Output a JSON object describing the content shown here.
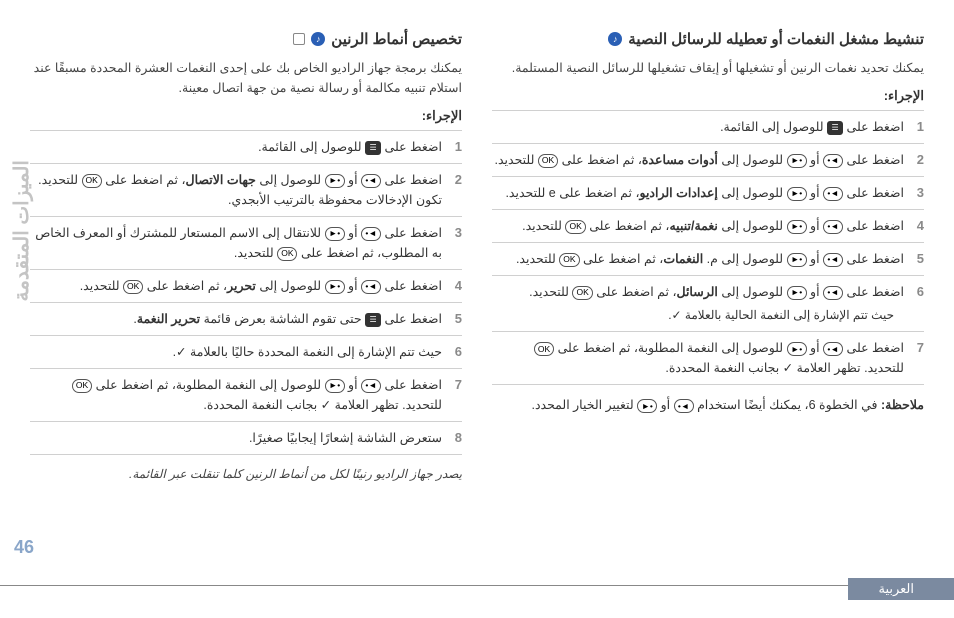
{
  "icons": {
    "menu": "☰",
    "left": "◄•",
    "right": "•►",
    "ok": "OK"
  },
  "right_col": {
    "title": "تنشيط مشغل النغمات أو تعطيله للرسائل النصية",
    "intro": "يمكنك تحديد نغمات الرنين أو تشغيلها أو إيقاف تشغيلها للرسائل النصية المستلمة.",
    "proc_label": "الإجراء:",
    "steps": [
      {
        "text": "اضغط على {menu} للوصول إلى القائمة."
      },
      {
        "text": "اضغط على {left} أو {right} للوصول إلى <b>أدوات مساعدة</b>، ثم اضغط على {ok} للتحديد."
      },
      {
        "text": "اضغط على {left} أو {right} للوصول إلى <b>إعدادات الراديو</b>، ثم اضغط على e للتحديد."
      },
      {
        "text": "اضغط على {left} أو {right} للوصول إلى <b>نغمة/تنبيه</b>، ثم اضغط على {ok} للتحديد."
      },
      {
        "text": "اضغط على {left} أو {right} للوصول إلى م. <b>النغمات</b>، ثم اضغط على {ok} للتحديد."
      },
      {
        "text": "اضغط على {left} أو {right} للوصول إلى <b>الرسائل</b>، ثم اضغط على {ok} للتحديد.",
        "sub": "حيث تتم الإشارة إلى النغمة الحالية بالعلامة ✓."
      },
      {
        "text": "اضغط على {left} أو {right} للوصول إلى النغمة المطلوبة، ثم اضغط على {ok} للتحديد. تظهر العلامة ✓ بجانب النغمة المحددة."
      }
    ],
    "note_label": "ملاحظة:",
    "note_text": "في الخطوة 6، يمكنك أيضًا استخدام {left} أو {right} لتغيير الخيار المحدد."
  },
  "left_col": {
    "title": "تخصيص أنماط الرنين",
    "intro": "يمكنك برمجة جهاز الراديو الخاص بك على إحدى النغمات العشرة المحددة مسبقًا عند استلام تنبيه مكالمة أو رسالة نصية من جهة اتصال معينة.",
    "proc_label": "الإجراء:",
    "steps": [
      {
        "text": "اضغط على {menu} للوصول إلى القائمة."
      },
      {
        "text": "اضغط على {left} أو {right} للوصول إلى <b>جهات الاتصال</b>، ثم اضغط على {ok} للتحديد. تكون الإدخالات محفوظة بالترتيب الأبجدي."
      },
      {
        "text": "اضغط على {left} أو {right} للانتقال إلى الاسم المستعار للمشترك أو المعرف الخاص به المطلوب، ثم اضغط على {ok} للتحديد."
      },
      {
        "text": "اضغط على {left} أو {right} للوصول إلى <b>تحرير</b>، ثم اضغط على {ok} للتحديد."
      },
      {
        "text": "اضغط على {menu} حتى تقوم الشاشة بعرض قائمة <b>تحرير النغمة</b>."
      },
      {
        "text": "حيث تتم الإشارة إلى النغمة المحددة حاليًا بالعلامة ✓."
      },
      {
        "text": "اضغط على {left} أو {right} للوصول إلى النغمة المطلوبة، ثم اضغط على {ok} للتحديد. تظهر العلامة ✓ بجانب النغمة المحددة."
      },
      {
        "text": "ستعرض الشاشة إشعارًا إيجابيًا صغيرًا."
      }
    ],
    "footnote": "يصدر جهاز الراديو رنينًا لكل من أنماط الرنين كلما تنقلت عبر القائمة."
  },
  "side_label": "الميزات المتقدمة",
  "page_num": "46",
  "lang": "العربية"
}
